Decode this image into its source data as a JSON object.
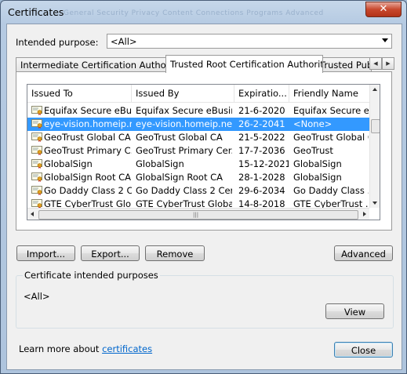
{
  "window": {
    "title": "Certificates",
    "close_glyph": "✕",
    "ghost_tabs": "General  Security  Privacy  Content  Connections  Programs  Advanced"
  },
  "purpose": {
    "label": "Intended purpose:",
    "value": "<All>"
  },
  "tabs": [
    {
      "label": "Intermediate Certification Authorities",
      "active": false
    },
    {
      "label": "Trusted Root Certification Authorities",
      "active": true
    },
    {
      "label": "Trusted Publ",
      "active": false
    }
  ],
  "tab_scroll": {
    "left": "◀",
    "right": "▶"
  },
  "columns": [
    "Issued To",
    "Issued By",
    "Expiratio...",
    "Friendly Name"
  ],
  "rows": [
    {
      "issued_to": "Equifax Secure eBu...",
      "issued_by": "Equifax Secure eBusin...",
      "expiration": "21-6-2020",
      "friendly": "Equifax Secure e...",
      "selected": false
    },
    {
      "issued_to": "eye-vision.homeip.net",
      "issued_by": "eye-vision.homeip.net",
      "expiration": "26-2-2041",
      "friendly": "<None>",
      "selected": true
    },
    {
      "issued_to": "GeoTrust Global CA",
      "issued_by": "GeoTrust Global CA",
      "expiration": "21-5-2022",
      "friendly": "GeoTrust Global CA",
      "selected": false
    },
    {
      "issued_to": "GeoTrust Primary C...",
      "issued_by": "GeoTrust Primary Cer...",
      "expiration": "17-7-2036",
      "friendly": "GeoTrust",
      "selected": false
    },
    {
      "issued_to": "GlobalSign",
      "issued_by": "GlobalSign",
      "expiration": "15-12-2021",
      "friendly": "GlobalSign",
      "selected": false
    },
    {
      "issued_to": "GlobalSign Root CA",
      "issued_by": "GlobalSign Root CA",
      "expiration": "28-1-2028",
      "friendly": "GlobalSign",
      "selected": false
    },
    {
      "issued_to": "Go Daddy Class 2 C...",
      "issued_by": "Go Daddy Class 2 Cert...",
      "expiration": "29-6-2034",
      "friendly": "Go Daddy Class ...",
      "selected": false
    },
    {
      "issued_to": "GTE CyberTrust Glo...",
      "issued_by": "GTE CyberTrust Globa...",
      "expiration": "14-8-2018",
      "friendly": "GTE CyberTrust ...",
      "selected": false
    }
  ],
  "buttons": {
    "import": "Import...",
    "export": "Export...",
    "remove": "Remove",
    "advanced": "Advanced",
    "view": "View",
    "close": "Close"
  },
  "intended_purposes": {
    "caption": "Certificate intended purposes",
    "value": "<All>"
  },
  "footer": {
    "text": "Learn more about ",
    "link": "certificates"
  },
  "icons": {
    "certificate": "certificate-icon"
  },
  "colors": {
    "selection": "#3399ff",
    "link": "#0066cc"
  }
}
